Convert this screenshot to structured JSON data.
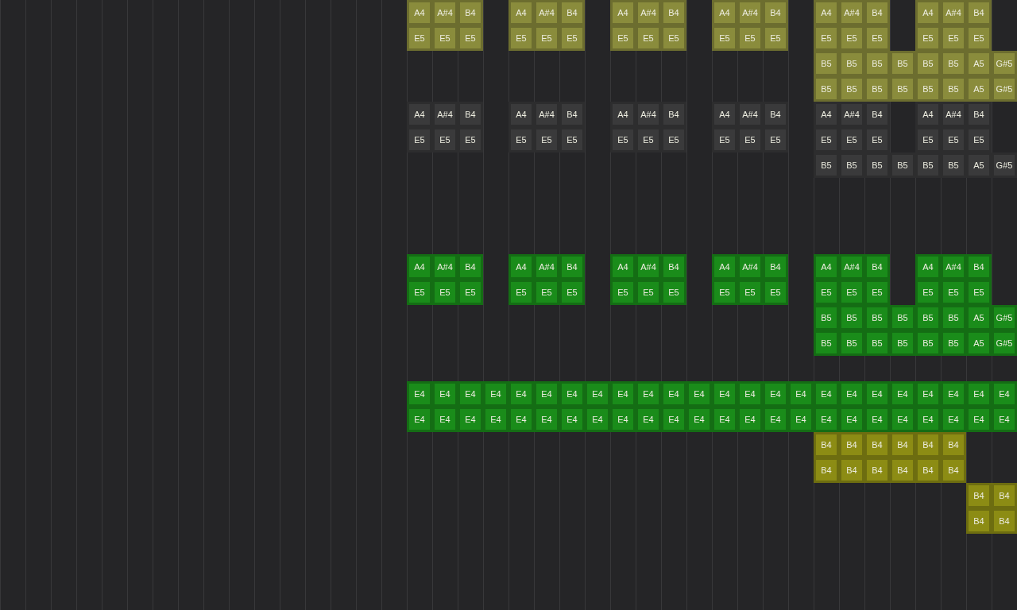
{
  "rows": [
    {
      "cells": [
        {
          "note": "A4",
          "color": "#8a8c3c"
        },
        {
          "note": "A#4",
          "color": "#8a8c3c"
        },
        {
          "note": "B4",
          "color": "#8a8c3c"
        },
        {},
        {
          "note": "A4",
          "color": "#8a8c3c"
        },
        {
          "note": "A#4",
          "color": "#8a8c3c"
        },
        {
          "note": "B4",
          "color": "#8a8c3c"
        },
        {},
        {
          "note": "A4",
          "color": "#8a8c3c"
        },
        {
          "note": "A#4",
          "color": "#8a8c3c"
        },
        {
          "note": "B4",
          "color": "#8a8c3c"
        },
        {},
        {
          "note": "A4",
          "color": "#8a8c3c"
        },
        {
          "note": "A#4",
          "color": "#8a8c3c"
        },
        {
          "note": "B4",
          "color": "#8a8c3c"
        },
        {},
        {
          "note": "A4",
          "color": "#8a8c3c"
        },
        {
          "note": "A#4",
          "color": "#8a8c3c"
        },
        {
          "note": "B4",
          "color": "#8a8c3c"
        },
        {},
        {
          "note": "A4",
          "color": "#8a8c3c"
        },
        {
          "note": "A#4",
          "color": "#8a8c3c"
        },
        {
          "note": "B4",
          "color": "#8a8c3c"
        },
        {}
      ]
    },
    {
      "cells": [
        {
          "note": "E5",
          "color": "#8a8c3c"
        },
        {
          "note": "E5",
          "color": "#8a8c3c"
        },
        {
          "note": "E5",
          "color": "#8a8c3c"
        },
        {},
        {
          "note": "E5",
          "color": "#8a8c3c"
        },
        {
          "note": "E5",
          "color": "#8a8c3c"
        },
        {
          "note": "E5",
          "color": "#8a8c3c"
        },
        {},
        {
          "note": "E5",
          "color": "#8a8c3c"
        },
        {
          "note": "E5",
          "color": "#8a8c3c"
        },
        {
          "note": "E5",
          "color": "#8a8c3c"
        },
        {},
        {
          "note": "E5",
          "color": "#8a8c3c"
        },
        {
          "note": "E5",
          "color": "#8a8c3c"
        },
        {
          "note": "E5",
          "color": "#8a8c3c"
        },
        {},
        {
          "note": "E5",
          "color": "#8a8c3c"
        },
        {
          "note": "E5",
          "color": "#8a8c3c"
        },
        {
          "note": "E5",
          "color": "#8a8c3c"
        },
        {},
        {
          "note": "E5",
          "color": "#8a8c3c"
        },
        {
          "note": "E5",
          "color": "#8a8c3c"
        },
        {
          "note": "E5",
          "color": "#8a8c3c"
        },
        {}
      ]
    },
    {
      "cells": [
        {},
        {},
        {},
        {},
        {},
        {},
        {},
        {},
        {},
        {},
        {},
        {},
        {},
        {},
        {},
        {},
        {
          "note": "B5",
          "color": "#8a8c3c"
        },
        {
          "note": "B5",
          "color": "#8a8c3c"
        },
        {
          "note": "B5",
          "color": "#8a8c3c"
        },
        {
          "note": "B5",
          "color": "#8a8c3c"
        },
        {
          "note": "B5",
          "color": "#8a8c3c"
        },
        {
          "note": "B5",
          "color": "#8a8c3c"
        },
        {
          "note": "A5",
          "color": "#8a8c3c"
        },
        {
          "note": "G#5",
          "color": "#8a8c3c"
        }
      ]
    },
    {
      "cells": [
        {},
        {},
        {},
        {},
        {},
        {},
        {},
        {},
        {},
        {},
        {},
        {},
        {},
        {},
        {},
        {},
        {
          "note": "B5",
          "color": "#8a8c3c"
        },
        {
          "note": "B5",
          "color": "#8a8c3c"
        },
        {
          "note": "B5",
          "color": "#8a8c3c"
        },
        {
          "note": "B5",
          "color": "#8a8c3c"
        },
        {
          "note": "B5",
          "color": "#8a8c3c"
        },
        {
          "note": "B5",
          "color": "#8a8c3c"
        },
        {
          "note": "A5",
          "color": "#8a8c3c"
        },
        {
          "note": "G#5",
          "color": "#8a8c3c"
        }
      ]
    },
    {
      "cells": [
        {
          "note": "A4",
          "color": "#3a3a3b"
        },
        {
          "note": "A#4",
          "color": "#3a3a3b"
        },
        {
          "note": "B4",
          "color": "#3a3a3b"
        },
        {},
        {
          "note": "A4",
          "color": "#3a3a3b"
        },
        {
          "note": "A#4",
          "color": "#3a3a3b"
        },
        {
          "note": "B4",
          "color": "#3a3a3b"
        },
        {},
        {
          "note": "A4",
          "color": "#3a3a3b"
        },
        {
          "note": "A#4",
          "color": "#3a3a3b"
        },
        {
          "note": "B4",
          "color": "#3a3a3b"
        },
        {},
        {
          "note": "A4",
          "color": "#3a3a3b"
        },
        {
          "note": "A#4",
          "color": "#3a3a3b"
        },
        {
          "note": "B4",
          "color": "#3a3a3b"
        },
        {},
        {
          "note": "A4",
          "color": "#3a3a3b"
        },
        {
          "note": "A#4",
          "color": "#3a3a3b"
        },
        {
          "note": "B4",
          "color": "#3a3a3b"
        },
        {},
        {
          "note": "A4",
          "color": "#3a3a3b"
        },
        {
          "note": "A#4",
          "color": "#3a3a3b"
        },
        {
          "note": "B4",
          "color": "#3a3a3b"
        },
        {}
      ]
    },
    {
      "cells": [
        {
          "note": "E5",
          "color": "#3a3a3b"
        },
        {
          "note": "E5",
          "color": "#3a3a3b"
        },
        {
          "note": "E5",
          "color": "#3a3a3b"
        },
        {},
        {
          "note": "E5",
          "color": "#3a3a3b"
        },
        {
          "note": "E5",
          "color": "#3a3a3b"
        },
        {
          "note": "E5",
          "color": "#3a3a3b"
        },
        {},
        {
          "note": "E5",
          "color": "#3a3a3b"
        },
        {
          "note": "E5",
          "color": "#3a3a3b"
        },
        {
          "note": "E5",
          "color": "#3a3a3b"
        },
        {},
        {
          "note": "E5",
          "color": "#3a3a3b"
        },
        {
          "note": "E5",
          "color": "#3a3a3b"
        },
        {
          "note": "E5",
          "color": "#3a3a3b"
        },
        {},
        {
          "note": "E5",
          "color": "#3a3a3b"
        },
        {
          "note": "E5",
          "color": "#3a3a3b"
        },
        {
          "note": "E5",
          "color": "#3a3a3b"
        },
        {},
        {
          "note": "E5",
          "color": "#3a3a3b"
        },
        {
          "note": "E5",
          "color": "#3a3a3b"
        },
        {
          "note": "E5",
          "color": "#3a3a3b"
        },
        {}
      ]
    },
    {
      "cells": [
        {},
        {},
        {},
        {},
        {},
        {},
        {},
        {},
        {},
        {},
        {},
        {},
        {},
        {},
        {},
        {},
        {
          "note": "B5",
          "color": "#3a3a3b"
        },
        {
          "note": "B5",
          "color": "#3a3a3b"
        },
        {
          "note": "B5",
          "color": "#3a3a3b"
        },
        {
          "note": "B5",
          "color": "#3a3a3b"
        },
        {
          "note": "B5",
          "color": "#3a3a3b"
        },
        {
          "note": "B5",
          "color": "#3a3a3b"
        },
        {
          "note": "A5",
          "color": "#3a3a3b"
        },
        {
          "note": "G#5",
          "color": "#3a3a3b"
        }
      ]
    },
    {},
    {},
    {},
    {
      "cells": [
        {
          "note": "A4",
          "color": "#1a8c1a"
        },
        {
          "note": "A#4",
          "color": "#1a8c1a"
        },
        {
          "note": "B4",
          "color": "#1a8c1a"
        },
        {},
        {
          "note": "A4",
          "color": "#1a8c1a"
        },
        {
          "note": "A#4",
          "color": "#1a8c1a"
        },
        {
          "note": "B4",
          "color": "#1a8c1a"
        },
        {},
        {
          "note": "A4",
          "color": "#1a8c1a"
        },
        {
          "note": "A#4",
          "color": "#1a8c1a"
        },
        {
          "note": "B4",
          "color": "#1a8c1a"
        },
        {},
        {
          "note": "A4",
          "color": "#1a8c1a"
        },
        {
          "note": "A#4",
          "color": "#1a8c1a"
        },
        {
          "note": "B4",
          "color": "#1a8c1a"
        },
        {},
        {
          "note": "A4",
          "color": "#1a8c1a"
        },
        {
          "note": "A#4",
          "color": "#1a8c1a"
        },
        {
          "note": "B4",
          "color": "#1a8c1a"
        },
        {},
        {
          "note": "A4",
          "color": "#1a8c1a"
        },
        {
          "note": "A#4",
          "color": "#1a8c1a"
        },
        {
          "note": "B4",
          "color": "#1a8c1a"
        },
        {}
      ]
    },
    {
      "cells": [
        {
          "note": "E5",
          "color": "#1a8c1a"
        },
        {
          "note": "E5",
          "color": "#1a8c1a"
        },
        {
          "note": "E5",
          "color": "#1a8c1a"
        },
        {},
        {
          "note": "E5",
          "color": "#1a8c1a"
        },
        {
          "note": "E5",
          "color": "#1a8c1a"
        },
        {
          "note": "E5",
          "color": "#1a8c1a"
        },
        {},
        {
          "note": "E5",
          "color": "#1a8c1a"
        },
        {
          "note": "E5",
          "color": "#1a8c1a"
        },
        {
          "note": "E5",
          "color": "#1a8c1a"
        },
        {},
        {
          "note": "E5",
          "color": "#1a8c1a"
        },
        {
          "note": "E5",
          "color": "#1a8c1a"
        },
        {
          "note": "E5",
          "color": "#1a8c1a"
        },
        {},
        {
          "note": "E5",
          "color": "#1a8c1a"
        },
        {
          "note": "E5",
          "color": "#1a8c1a"
        },
        {
          "note": "E5",
          "color": "#1a8c1a"
        },
        {},
        {
          "note": "E5",
          "color": "#1a8c1a"
        },
        {
          "note": "E5",
          "color": "#1a8c1a"
        },
        {
          "note": "E5",
          "color": "#1a8c1a"
        },
        {}
      ]
    },
    {
      "cells": [
        {},
        {},
        {},
        {},
        {},
        {},
        {},
        {},
        {},
        {},
        {},
        {},
        {},
        {},
        {},
        {},
        {
          "note": "B5",
          "color": "#1a8c1a"
        },
        {
          "note": "B5",
          "color": "#1a8c1a"
        },
        {
          "note": "B5",
          "color": "#1a8c1a"
        },
        {
          "note": "B5",
          "color": "#1a8c1a"
        },
        {
          "note": "B5",
          "color": "#1a8c1a"
        },
        {
          "note": "B5",
          "color": "#1a8c1a"
        },
        {
          "note": "A5",
          "color": "#1a8c1a"
        },
        {
          "note": "G#5",
          "color": "#1a8c1a"
        }
      ]
    },
    {
      "cells": [
        {},
        {},
        {},
        {},
        {},
        {},
        {},
        {},
        {},
        {},
        {},
        {},
        {},
        {},
        {},
        {},
        {
          "note": "B5",
          "color": "#1a8c1a"
        },
        {
          "note": "B5",
          "color": "#1a8c1a"
        },
        {
          "note": "B5",
          "color": "#1a8c1a"
        },
        {
          "note": "B5",
          "color": "#1a8c1a"
        },
        {
          "note": "B5",
          "color": "#1a8c1a"
        },
        {
          "note": "B5",
          "color": "#1a8c1a"
        },
        {
          "note": "A5",
          "color": "#1a8c1a"
        },
        {
          "note": "G#5",
          "color": "#1a8c1a"
        }
      ]
    },
    {},
    {
      "cells": [
        {
          "note": "E4",
          "color": "#1a8c1a"
        },
        {
          "note": "E4",
          "color": "#1a8c1a"
        },
        {
          "note": "E4",
          "color": "#1a8c1a"
        },
        {
          "note": "E4",
          "color": "#1a8c1a"
        },
        {
          "note": "E4",
          "color": "#1a8c1a"
        },
        {
          "note": "E4",
          "color": "#1a8c1a"
        },
        {
          "note": "E4",
          "color": "#1a8c1a"
        },
        {
          "note": "E4",
          "color": "#1a8c1a"
        },
        {
          "note": "E4",
          "color": "#1a8c1a"
        },
        {
          "note": "E4",
          "color": "#1a8c1a"
        },
        {
          "note": "E4",
          "color": "#1a8c1a"
        },
        {
          "note": "E4",
          "color": "#1a8c1a"
        },
        {
          "note": "E4",
          "color": "#1a8c1a"
        },
        {
          "note": "E4",
          "color": "#1a8c1a"
        },
        {
          "note": "E4",
          "color": "#1a8c1a"
        },
        {
          "note": "E4",
          "color": "#1a8c1a"
        },
        {
          "note": "E4",
          "color": "#1a8c1a"
        },
        {
          "note": "E4",
          "color": "#1a8c1a"
        },
        {
          "note": "E4",
          "color": "#1a8c1a"
        },
        {
          "note": "E4",
          "color": "#1a8c1a"
        },
        {
          "note": "E4",
          "color": "#1a8c1a"
        },
        {
          "note": "E4",
          "color": "#1a8c1a"
        },
        {
          "note": "E4",
          "color": "#1a8c1a"
        },
        {
          "note": "E4",
          "color": "#1a8c1a"
        }
      ]
    },
    {
      "cells": [
        {
          "note": "E4",
          "color": "#1a8c1a"
        },
        {
          "note": "E4",
          "color": "#1a8c1a"
        },
        {
          "note": "E4",
          "color": "#1a8c1a"
        },
        {
          "note": "E4",
          "color": "#1a8c1a"
        },
        {
          "note": "E4",
          "color": "#1a8c1a"
        },
        {
          "note": "E4",
          "color": "#1a8c1a"
        },
        {
          "note": "E4",
          "color": "#1a8c1a"
        },
        {
          "note": "E4",
          "color": "#1a8c1a"
        },
        {
          "note": "E4",
          "color": "#1a8c1a"
        },
        {
          "note": "E4",
          "color": "#1a8c1a"
        },
        {
          "note": "E4",
          "color": "#1a8c1a"
        },
        {
          "note": "E4",
          "color": "#1a8c1a"
        },
        {
          "note": "E4",
          "color": "#1a8c1a"
        },
        {
          "note": "E4",
          "color": "#1a8c1a"
        },
        {
          "note": "E4",
          "color": "#1a8c1a"
        },
        {
          "note": "E4",
          "color": "#1a8c1a"
        },
        {
          "note": "E4",
          "color": "#1a8c1a"
        },
        {
          "note": "E4",
          "color": "#1a8c1a"
        },
        {
          "note": "E4",
          "color": "#1a8c1a"
        },
        {
          "note": "E4",
          "color": "#1a8c1a"
        },
        {
          "note": "E4",
          "color": "#1a8c1a"
        },
        {
          "note": "E4",
          "color": "#1a8c1a"
        },
        {
          "note": "E4",
          "color": "#1a8c1a"
        },
        {
          "note": "E4",
          "color": "#1a8c1a"
        }
      ]
    },
    {
      "cells": [
        {},
        {},
        {},
        {},
        {},
        {},
        {},
        {},
        {},
        {},
        {},
        {},
        {},
        {},
        {},
        {},
        {
          "note": "B4",
          "color": "#8c8c14"
        },
        {
          "note": "B4",
          "color": "#8c8c14"
        },
        {
          "note": "B4",
          "color": "#8c8c14"
        },
        {
          "note": "B4",
          "color": "#8c8c14"
        },
        {
          "note": "B4",
          "color": "#8c8c14"
        },
        {
          "note": "B4",
          "color": "#8c8c14"
        },
        {},
        {}
      ]
    },
    {
      "cells": [
        {},
        {},
        {},
        {},
        {},
        {},
        {},
        {},
        {},
        {},
        {},
        {},
        {},
        {},
        {},
        {},
        {
          "note": "B4",
          "color": "#8c8c14"
        },
        {
          "note": "B4",
          "color": "#8c8c14"
        },
        {
          "note": "B4",
          "color": "#8c8c14"
        },
        {
          "note": "B4",
          "color": "#8c8c14"
        },
        {
          "note": "B4",
          "color": "#8c8c14"
        },
        {
          "note": "B4",
          "color": "#8c8c14"
        },
        {},
        {}
      ]
    },
    {
      "cells": [
        {},
        {},
        {},
        {},
        {},
        {},
        {},
        {},
        {},
        {},
        {},
        {},
        {},
        {},
        {},
        {},
        {},
        {},
        {},
        {},
        {},
        {},
        {
          "note": "B4",
          "color": "#8c8c14"
        },
        {
          "note": "B4",
          "color": "#8c8c14"
        }
      ]
    },
    {
      "cells": [
        {},
        {},
        {},
        {},
        {},
        {},
        {},
        {},
        {},
        {},
        {},
        {},
        {},
        {},
        {},
        {},
        {},
        {},
        {},
        {},
        {},
        {},
        {
          "note": "B4",
          "color": "#8c8c14"
        },
        {
          "note": "B4",
          "color": "#8c8c14"
        }
      ]
    },
    {},
    {},
    {}
  ]
}
